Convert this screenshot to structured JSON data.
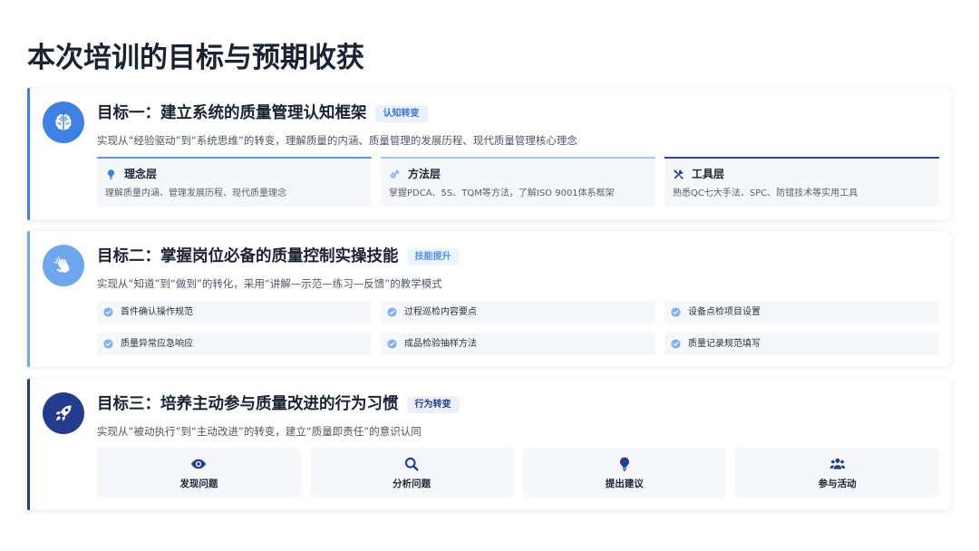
{
  "page": {
    "title": "本次培训的目标与预期收获"
  },
  "goals": [
    {
      "icon": "brain-icon",
      "title": "目标一：建立系统的质量管理认知框架",
      "badge": "认知转变",
      "description": "实现从“经验驱动”到“系统思维”的转变，理解质量的内涵、质量管理的发展历程、现代质量管理核心理念",
      "colors": {
        "accent": "#3f80e4",
        "badge_bg": "#e9f1fd",
        "badge_text": "#3a72d8"
      },
      "layers": [
        {
          "icon": "lightbulb-icon",
          "color": "#3f80e4",
          "border": "#5e96e9",
          "title": "理念层",
          "text": "理解质量内涵、管理发展历程、现代质量理念"
        },
        {
          "icon": "gears-icon",
          "color": "#7fb0ef",
          "border": "#a5c6f2",
          "title": "方法层",
          "text": "掌握PDCA、5S、TQM等方法，了解ISO 9001体系框架"
        },
        {
          "icon": "tools-icon",
          "color": "#233c8e",
          "border": "#2d4592",
          "title": "工具层",
          "text": "熟悉QC七大手法、SPC、防错技术等实用工具"
        }
      ]
    },
    {
      "icon": "clapping-hands-icon",
      "title": "目标二：掌握岗位必备的质量控制实操技能",
      "badge": "技能提升",
      "description": "实现从“知道”到“做到”的转化，采用“讲解—示范—练习—反馈”的教学模式",
      "colors": {
        "accent": "#6fa7ef",
        "badge_bg": "#edf4fe",
        "badge_text": "#5a93e6",
        "item_icon": "#7fb0ef"
      },
      "item_icon": "check-circle-icon",
      "skills": [
        "首件确认操作规范",
        "过程巡检内容要点",
        "设备点检项目设置",
        "质量异常应急响应",
        "成品检验抽样方法",
        "质量记录规范填写"
      ]
    },
    {
      "icon": "rocket-icon",
      "title": "目标三：培养主动参与质量改进的行为习惯",
      "badge": "行为转变",
      "description": "实现从“被动执行”到“主动改进”的转变，建立“质量即责任”的意识认同",
      "colors": {
        "accent": "#233c8e",
        "badge_bg": "#edf0f8",
        "badge_text": "#233c8e",
        "item_icon": "#233c8e"
      },
      "behaviors": [
        {
          "icon": "eye-icon",
          "label": "发现问题"
        },
        {
          "icon": "search-icon",
          "label": "分析问题"
        },
        {
          "icon": "lightbulb-icon",
          "label": "提出建议"
        },
        {
          "icon": "users-icon",
          "label": "参与活动"
        }
      ]
    }
  ]
}
